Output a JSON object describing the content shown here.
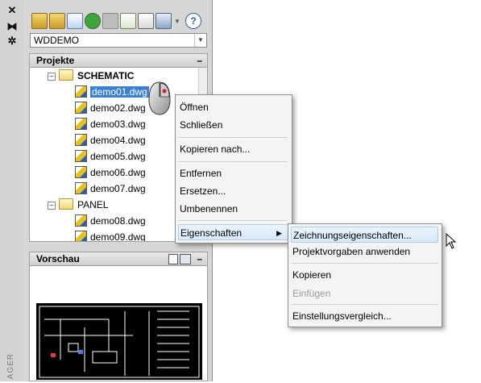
{
  "palette": {
    "side_title": "AGER",
    "side_icons": [
      "close-icon",
      "pin-icon",
      "properties-icon"
    ],
    "side_glyphs": [
      "✕",
      "⧓",
      "✲"
    ]
  },
  "toolbar": {
    "icons": [
      "open-project-icon",
      "new-project-icon",
      "new-drawing-icon",
      "refresh-icon",
      "update-icon",
      "project-task-icon",
      "publish-icon",
      "plot-icon",
      "help-icon"
    ],
    "help_glyph": "?"
  },
  "project_combo": {
    "value": "WDDEMO"
  },
  "projects_panel": {
    "title": "Projekte",
    "min_glyph": "–",
    "tree": [
      {
        "label": "SCHEMATIC",
        "type": "folder",
        "expand": "–",
        "bold": true
      },
      {
        "label": "demo01.dwg",
        "type": "drawing",
        "selected": true
      },
      {
        "label": "demo02.dwg",
        "type": "drawing"
      },
      {
        "label": "demo03.dwg",
        "type": "drawing"
      },
      {
        "label": "demo04.dwg",
        "type": "drawing"
      },
      {
        "label": "demo05.dwg",
        "type": "drawing"
      },
      {
        "label": "demo06.dwg",
        "type": "drawing"
      },
      {
        "label": "demo07.dwg",
        "type": "drawing"
      },
      {
        "label": "PANEL",
        "type": "folder",
        "expand": "–"
      },
      {
        "label": "demo08.dwg",
        "type": "drawing"
      },
      {
        "label": "demo09.dwg",
        "type": "drawing"
      }
    ]
  },
  "preview_panel": {
    "title": "Vorschau",
    "min_glyph": "–"
  },
  "context_menu": {
    "items": [
      {
        "label": "Öffnen"
      },
      {
        "label": "Schließen"
      },
      {
        "label": "Kopieren nach..."
      },
      {
        "label": "Entfernen"
      },
      {
        "label": "Ersetzen..."
      },
      {
        "label": "Umbenennen"
      },
      {
        "label": "Eigenschaften",
        "submenu": "▶",
        "highlighted": true
      }
    ]
  },
  "sub_menu": {
    "items": [
      {
        "label": "Zeichnungseigenschaften...",
        "highlighted": true
      },
      {
        "label": "Projektvorgaben anwenden"
      },
      {
        "label": "Kopieren"
      },
      {
        "label": "Einfügen",
        "disabled": true
      },
      {
        "label": "Einstellungsvergleich..."
      }
    ]
  }
}
